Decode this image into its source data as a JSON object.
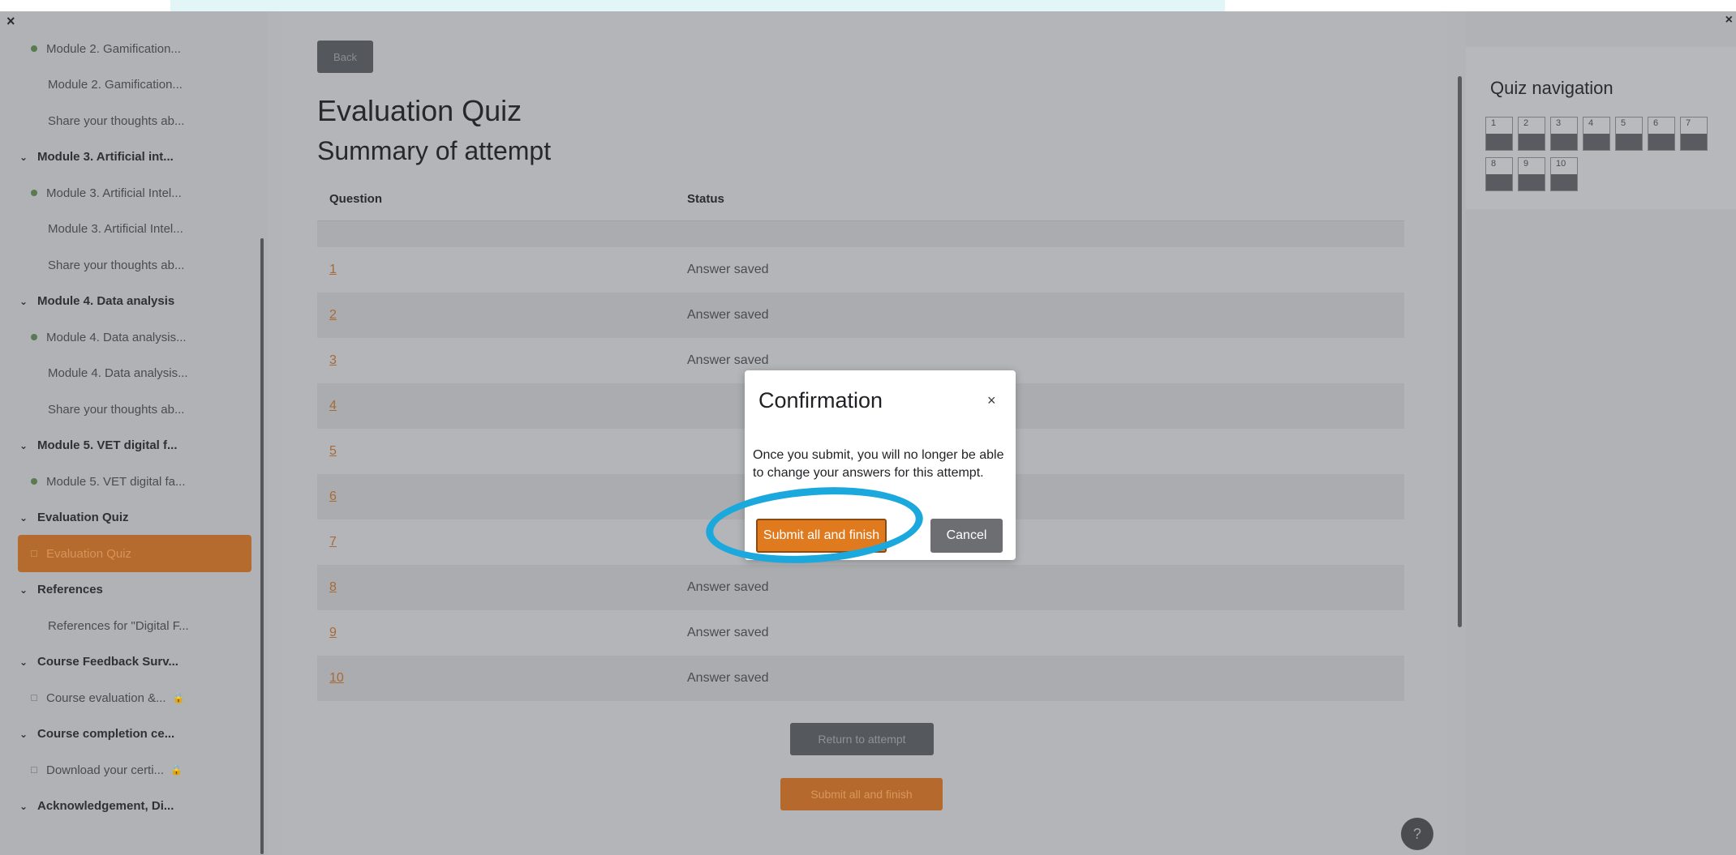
{
  "drawer": {
    "close_icon": "×",
    "items": [
      {
        "type": "activity",
        "marker": "dot",
        "label": "Module 2. Gamification..."
      },
      {
        "type": "activity",
        "marker": "none",
        "label": "Module 2. Gamification..."
      },
      {
        "type": "activity",
        "marker": "none",
        "label": "Share your thoughts ab..."
      },
      {
        "type": "section",
        "label": "Module 3. Artificial int..."
      },
      {
        "type": "activity",
        "marker": "dot",
        "label": "Module 3. Artificial Intel..."
      },
      {
        "type": "activity",
        "marker": "none",
        "label": "Module 3. Artificial Intel..."
      },
      {
        "type": "activity",
        "marker": "none",
        "label": "Share your thoughts ab..."
      },
      {
        "type": "section",
        "label": "Module 4. Data analysis"
      },
      {
        "type": "activity",
        "marker": "dot",
        "label": "Module 4. Data analysis..."
      },
      {
        "type": "activity",
        "marker": "none",
        "label": "Module 4. Data analysis..."
      },
      {
        "type": "activity",
        "marker": "none",
        "label": "Share your thoughts ab..."
      },
      {
        "type": "section",
        "label": "Module 5. VET digital f..."
      },
      {
        "type": "activity",
        "marker": "dot",
        "label": "Module 5. VET digital fa..."
      },
      {
        "type": "section",
        "label": "Evaluation Quiz"
      },
      {
        "type": "active",
        "marker": "square",
        "label": "Evaluation Quiz"
      },
      {
        "type": "section",
        "label": "References"
      },
      {
        "type": "activity",
        "marker": "none",
        "label": "References for \"Digital F..."
      },
      {
        "type": "section",
        "label": "Course Feedback Surv..."
      },
      {
        "type": "activity",
        "marker": "square",
        "label": "Course evaluation &...",
        "locked": true
      },
      {
        "type": "section",
        "label": "Course completion ce..."
      },
      {
        "type": "activity",
        "marker": "square",
        "label": "Download your certi...",
        "locked": true
      },
      {
        "type": "section",
        "label": "Acknowledgement, Di..."
      }
    ]
  },
  "main": {
    "back_label": "Back",
    "quiz_title": "Evaluation Quiz",
    "summary_title": "Summary of attempt",
    "table": {
      "headers": [
        "Question",
        "Status"
      ],
      "rows": [
        {
          "q": "1",
          "status": "Answer saved"
        },
        {
          "q": "2",
          "status": "Answer saved"
        },
        {
          "q": "3",
          "status": "Answer saved"
        },
        {
          "q": "4",
          "status": ""
        },
        {
          "q": "5",
          "status": ""
        },
        {
          "q": "6",
          "status": ""
        },
        {
          "q": "7",
          "status": ""
        },
        {
          "q": "8",
          "status": "Answer saved"
        },
        {
          "q": "9",
          "status": "Answer saved"
        },
        {
          "q": "10",
          "status": "Answer saved"
        }
      ]
    },
    "return_label": "Return to attempt",
    "submit_label": "Submit all and finish",
    "help_icon": "?"
  },
  "quiz_nav": {
    "close_icon": "×",
    "title": "Quiz navigation",
    "buttons": [
      "1",
      "2",
      "3",
      "4",
      "5",
      "6",
      "7",
      "8",
      "9",
      "10"
    ]
  },
  "modal": {
    "title": "Confirmation",
    "close_icon": "×",
    "body": "Once you submit, you will no longer be able to change your answers for this attempt.",
    "submit_label": "Submit all and finish",
    "cancel_label": "Cancel"
  },
  "colors": {
    "accent": "#e07a1f",
    "highlight_ring": "#1ba8dd",
    "overlay": "#b3b5b8"
  }
}
